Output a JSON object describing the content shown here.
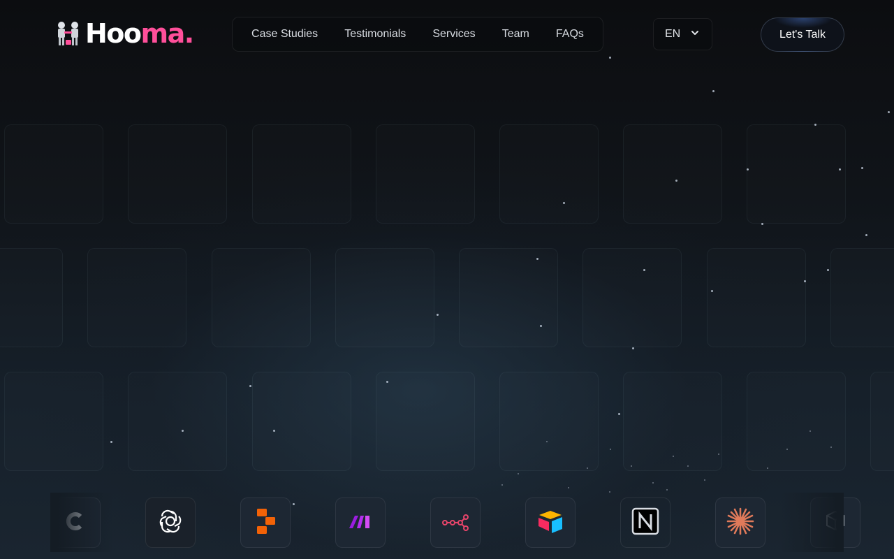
{
  "brand": {
    "name_part1": "Hoo",
    "name_part2": "ma.",
    "pink": "#ff4f9a"
  },
  "nav": {
    "items": [
      {
        "label": "Case Studies"
      },
      {
        "label": "Testimonials"
      },
      {
        "label": "Services"
      },
      {
        "label": "Team"
      },
      {
        "label": "FAQs"
      }
    ]
  },
  "language": {
    "selected": "EN",
    "icon": "chevron-down-icon"
  },
  "cta": {
    "label": "Let's Talk"
  },
  "tools": [
    {
      "name": "c-logo-icon"
    },
    {
      "name": "openai-icon"
    },
    {
      "name": "replit-icon"
    },
    {
      "name": "make-icon"
    },
    {
      "name": "n8n-icon"
    },
    {
      "name": "airtable-icon"
    },
    {
      "name": "notion-icon"
    },
    {
      "name": "claude-icon"
    },
    {
      "name": "cube-icon"
    }
  ]
}
